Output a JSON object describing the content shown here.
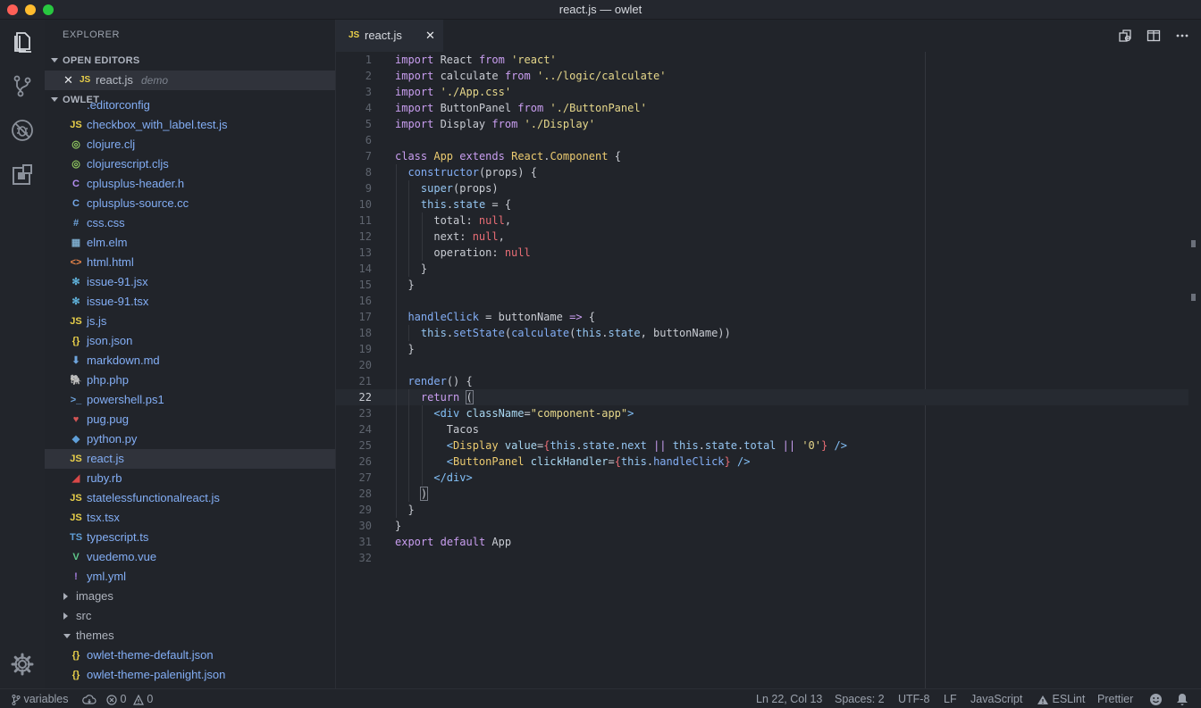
{
  "window": {
    "title": "react.js — owlet"
  },
  "activity": {
    "icons": [
      "explorer-icon",
      "source-control-icon",
      "debug-icon",
      "extensions-icon",
      "settings-gear-icon"
    ]
  },
  "explorer": {
    "header": "EXPLORER",
    "open_editors_title": "OPEN EDITORS",
    "open_editor": {
      "close": "✕",
      "icon": "JS",
      "name": "react.js",
      "description": "demo"
    },
    "workspace_title": "OWLET",
    "files": [
      {
        "name": ".editorconfig",
        "icon": "",
        "color": "#aeb3bd"
      },
      {
        "name": "checkbox_with_label.test.js",
        "icon": "JS",
        "color": "#e8cf4a"
      },
      {
        "name": "clojure.clj",
        "icon": "◎",
        "color": "#8fc860"
      },
      {
        "name": "clojurescript.cljs",
        "icon": "◎",
        "color": "#8fc860"
      },
      {
        "name": "cplusplus-header.h",
        "icon": "C",
        "color": "#b48ef0"
      },
      {
        "name": "cplusplus-source.cc",
        "icon": "C",
        "color": "#74a8e8"
      },
      {
        "name": "css.css",
        "icon": "#",
        "color": "#6fa5dd"
      },
      {
        "name": "elm.elm",
        "icon": "▦",
        "color": "#7aa8c8"
      },
      {
        "name": "html.html",
        "icon": "<>",
        "color": "#e8854a"
      },
      {
        "name": "issue-91.jsx",
        "icon": "✻",
        "color": "#5fb0d8"
      },
      {
        "name": "issue-91.tsx",
        "icon": "✻",
        "color": "#5fb0d8"
      },
      {
        "name": "js.js",
        "icon": "JS",
        "color": "#e8cf4a"
      },
      {
        "name": "json.json",
        "icon": "{}",
        "color": "#e8cf4a"
      },
      {
        "name": "markdown.md",
        "icon": "⬇",
        "color": "#6fa5dd"
      },
      {
        "name": "php.php",
        "icon": "🐘",
        "color": "#a67de0"
      },
      {
        "name": "powershell.ps1",
        "icon": ">_",
        "color": "#6fa5dd"
      },
      {
        "name": "pug.pug",
        "icon": "♥",
        "color": "#d45555"
      },
      {
        "name": "python.py",
        "icon": "◆",
        "color": "#5f9fd8"
      },
      {
        "name": "react.js",
        "icon": "JS",
        "color": "#e8cf4a",
        "active": true
      },
      {
        "name": "ruby.rb",
        "icon": "◢",
        "color": "#d94848"
      },
      {
        "name": "statelessfunctionalreact.js",
        "icon": "JS",
        "color": "#e8cf4a"
      },
      {
        "name": "tsx.tsx",
        "icon": "JS",
        "color": "#e8cf4a"
      },
      {
        "name": "typescript.ts",
        "icon": "TS",
        "color": "#5f9fd8"
      },
      {
        "name": "vuedemo.vue",
        "icon": "V",
        "color": "#5fc88a"
      },
      {
        "name": "yml.yml",
        "icon": "!",
        "color": "#a67de0"
      }
    ],
    "folders": [
      {
        "name": "images",
        "expanded": false
      },
      {
        "name": "src",
        "expanded": false
      },
      {
        "name": "themes",
        "expanded": true
      }
    ],
    "theme_files": [
      {
        "name": "owlet-theme-default.json",
        "icon": "{}",
        "color": "#e8cf4a"
      },
      {
        "name": "owlet-theme-palenight.json",
        "icon": "{}",
        "color": "#e8cf4a"
      }
    ]
  },
  "tab": {
    "icon": "JS",
    "name": "react.js",
    "close": "✕"
  },
  "tab_actions": [
    "open-changes-icon",
    "split-editor-icon",
    "more-actions-icon"
  ],
  "editor": {
    "current_line": 22,
    "lines": [
      [
        [
          "kw",
          "import"
        ],
        [
          "p",
          " React "
        ],
        [
          "kw",
          "from"
        ],
        [
          "p",
          " "
        ],
        [
          "str",
          "'react'"
        ]
      ],
      [
        [
          "kw",
          "import"
        ],
        [
          "p",
          " calculate "
        ],
        [
          "kw",
          "from"
        ],
        [
          "p",
          " "
        ],
        [
          "str",
          "'../logic/calculate'"
        ]
      ],
      [
        [
          "kw",
          "import"
        ],
        [
          "p",
          " "
        ],
        [
          "str",
          "'./App.css'"
        ]
      ],
      [
        [
          "kw",
          "import"
        ],
        [
          "p",
          " ButtonPanel "
        ],
        [
          "kw",
          "from"
        ],
        [
          "p",
          " "
        ],
        [
          "str",
          "'./ButtonPanel'"
        ]
      ],
      [
        [
          "kw",
          "import"
        ],
        [
          "p",
          " Display "
        ],
        [
          "kw",
          "from"
        ],
        [
          "p",
          " "
        ],
        [
          "str",
          "'./Display'"
        ]
      ],
      [],
      [
        [
          "kw",
          "class"
        ],
        [
          "p",
          " "
        ],
        [
          "cls",
          "App"
        ],
        [
          "p",
          " "
        ],
        [
          "kw",
          "extends"
        ],
        [
          "p",
          " "
        ],
        [
          "cls",
          "React"
        ],
        [
          "p",
          "."
        ],
        [
          "cls",
          "Component"
        ],
        [
          "p",
          " {"
        ]
      ],
      [
        [
          "p",
          "  "
        ],
        [
          "fn",
          "constructor"
        ],
        [
          "p",
          "(props) {"
        ]
      ],
      [
        [
          "p",
          "    "
        ],
        [
          "thiskw",
          "super"
        ],
        [
          "p",
          "(props)"
        ]
      ],
      [
        [
          "p",
          "    "
        ],
        [
          "thiskw",
          "this"
        ],
        [
          "p",
          "."
        ],
        [
          "thiskw",
          "state"
        ],
        [
          "p",
          " = {"
        ]
      ],
      [
        [
          "p",
          "      total: "
        ],
        [
          "nul",
          "null"
        ],
        [
          "p",
          ","
        ]
      ],
      [
        [
          "p",
          "      next: "
        ],
        [
          "nul",
          "null"
        ],
        [
          "p",
          ","
        ]
      ],
      [
        [
          "p",
          "      operation: "
        ],
        [
          "nul",
          "null"
        ]
      ],
      [
        [
          "p",
          "    }"
        ]
      ],
      [
        [
          "p",
          "  }"
        ]
      ],
      [],
      [
        [
          "p",
          "  "
        ],
        [
          "fn",
          "handleClick"
        ],
        [
          "p",
          " = buttonName "
        ],
        [
          "kw",
          "=>"
        ],
        [
          "p",
          " {"
        ]
      ],
      [
        [
          "p",
          "    "
        ],
        [
          "thiskw",
          "this"
        ],
        [
          "p",
          "."
        ],
        [
          "fn",
          "setState"
        ],
        [
          "p",
          "("
        ],
        [
          "fn",
          "calculate"
        ],
        [
          "p",
          "("
        ],
        [
          "thiskw",
          "this"
        ],
        [
          "p",
          "."
        ],
        [
          "thiskw",
          "state"
        ],
        [
          "p",
          ", buttonName))"
        ]
      ],
      [
        [
          "p",
          "  }"
        ]
      ],
      [],
      [
        [
          "p",
          "  "
        ],
        [
          "fn",
          "render"
        ],
        [
          "p",
          "() {"
        ]
      ],
      [
        [
          "p",
          "    "
        ],
        [
          "kw",
          "return"
        ],
        [
          "p",
          " "
        ],
        [
          "box",
          "("
        ]
      ],
      [
        [
          "p",
          "      "
        ],
        [
          "tag",
          "<div"
        ],
        [
          "p",
          " "
        ],
        [
          "attr",
          "className"
        ],
        [
          "p",
          "="
        ],
        [
          "str",
          "\"component-app\""
        ],
        [
          "tag",
          ">"
        ]
      ],
      [
        [
          "p",
          "        Tacos"
        ]
      ],
      [
        [
          "p",
          "        "
        ],
        [
          "tag",
          "<"
        ],
        [
          "cls",
          "Display"
        ],
        [
          "p",
          " "
        ],
        [
          "attr",
          "value"
        ],
        [
          "p",
          "="
        ],
        [
          "brace",
          "{"
        ],
        [
          "thiskw",
          "this"
        ],
        [
          "p",
          "."
        ],
        [
          "thiskw",
          "state"
        ],
        [
          "p",
          "."
        ],
        [
          "thiskw",
          "next"
        ],
        [
          "p",
          " "
        ],
        [
          "kw",
          "||"
        ],
        [
          "p",
          " "
        ],
        [
          "thiskw",
          "this"
        ],
        [
          "p",
          "."
        ],
        [
          "thiskw",
          "state"
        ],
        [
          "p",
          "."
        ],
        [
          "thiskw",
          "total"
        ],
        [
          "p",
          " "
        ],
        [
          "kw",
          "||"
        ],
        [
          "p",
          " "
        ],
        [
          "str",
          "'0'"
        ],
        [
          "brace",
          "}"
        ],
        [
          "p",
          " "
        ],
        [
          "tag",
          "/>"
        ]
      ],
      [
        [
          "p",
          "        "
        ],
        [
          "tag",
          "<"
        ],
        [
          "cls",
          "ButtonPanel"
        ],
        [
          "p",
          " "
        ],
        [
          "attr",
          "clickHandler"
        ],
        [
          "p",
          "="
        ],
        [
          "brace",
          "{"
        ],
        [
          "thiskw",
          "this"
        ],
        [
          "p",
          "."
        ],
        [
          "fn",
          "handleClick"
        ],
        [
          "brace",
          "}"
        ],
        [
          "p",
          " "
        ],
        [
          "tag",
          "/>"
        ]
      ],
      [
        [
          "p",
          "      "
        ],
        [
          "tag",
          "</div>"
        ]
      ],
      [
        [
          "p",
          "    "
        ],
        [
          "box",
          ")"
        ]
      ],
      [
        [
          "p",
          "  }"
        ]
      ],
      [
        [
          "p",
          "}"
        ]
      ],
      [
        [
          "kw",
          "export"
        ],
        [
          "p",
          " "
        ],
        [
          "kw",
          "default"
        ],
        [
          "p",
          " App"
        ]
      ],
      []
    ]
  },
  "status": {
    "branch": "variables",
    "errors": "0",
    "warnings": "0",
    "position": "Ln 22, Col 13",
    "spaces": "Spaces: 2",
    "encoding": "UTF-8",
    "eol": "LF",
    "language": "JavaScript",
    "eslint": "ESLint",
    "prettier": "Prettier"
  }
}
